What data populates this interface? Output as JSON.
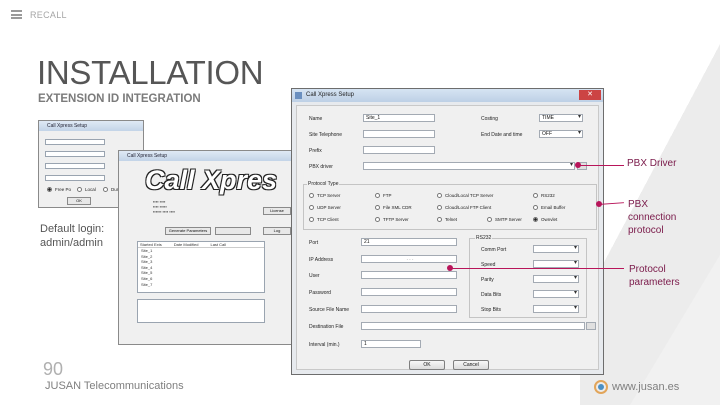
{
  "header": {
    "recall": "RECALL"
  },
  "title": "INSTALLATION",
  "subtitle": "EXTENSION ID INTEGRATION",
  "login_note": "Default login: admin/admin",
  "page_number": "90",
  "company": "JUSAN Telecommunications",
  "website": "www.jusan.es",
  "callouts": [
    {
      "label": "PBX Driver"
    },
    {
      "label": "PBX connection protocol"
    },
    {
      "label": "Protocol parameters"
    }
  ],
  "small_window": {
    "title": "Call Xpress Setup",
    "ok": "OK",
    "options": [
      "Free Po",
      "Local",
      "Dur"
    ]
  },
  "cx_window": {
    "title": "Call Xpress Setup",
    "logo": "Call Xpres",
    "buttons": [
      "License",
      "Generate Parameters",
      "Log"
    ],
    "columns": [
      "Started Exts",
      "Date Modified",
      "Last Call"
    ],
    "list": [
      "Site_1",
      "Site_2",
      "Site_3",
      "Site_4",
      "Site_5",
      "Site_6",
      "Site_7"
    ]
  },
  "setup_window": {
    "title": "Call Xpress Setup",
    "fields": {
      "name_label": "Name",
      "name_value": "Site_1",
      "site_telephone_label": "Site Telephone",
      "prefix_label": "Prefix",
      "pbx_driver_label": "PBX driver",
      "costing_label": "Costing",
      "costing_value": "TIME",
      "end_date_label": "End Date and time",
      "end_date_value": "OFF",
      "protocol_label": "Protocol Type",
      "port_label": "Port",
      "port_value": "21",
      "ip_label": "IP Address",
      "ip_value": ". . .",
      "user_label": "User",
      "password_label": "Password",
      "source_file_label": "Source File Name",
      "dest_file_label": "Destination File",
      "interval_label": "Interval (min.)",
      "interval_value": "1"
    },
    "protocols": [
      "TCP Server",
      "FTP",
      "Cloud/Local TCP Server",
      "RS232",
      "UDP Server",
      "File XML CDR",
      "Cloud/Local FTP Client",
      "Email Buffer",
      "TCP Client",
      "TFTP Server",
      "Telnet",
      "SMTP Server",
      "Ownvlet"
    ],
    "rs232": {
      "title": "RS232",
      "comm_port": "Comm Port",
      "speed": "Speed",
      "parity": "Parity",
      "data_bits": "Data Bits",
      "stop_bits": "Stop Bits"
    },
    "ok": "OK",
    "cancel": "Cancel"
  },
  "colors": {
    "accent": "#b8155a",
    "title": "#565656"
  }
}
